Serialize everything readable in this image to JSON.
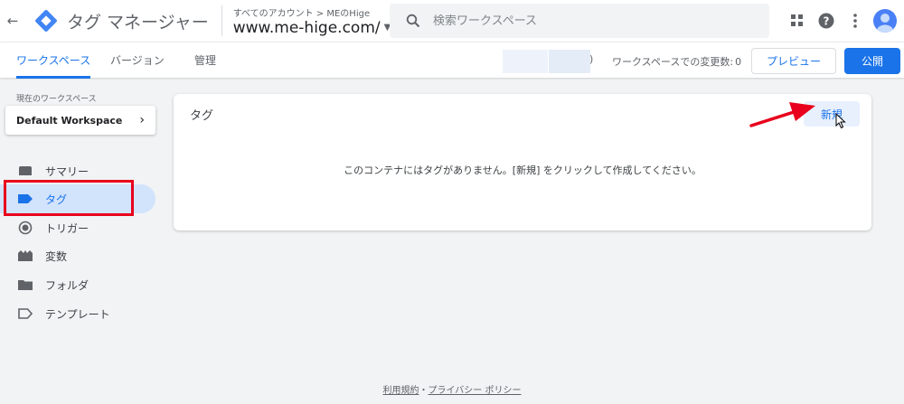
{
  "app": {
    "back_label": "←",
    "title": "タグ マネージャー",
    "breadcrumb": "すべてのアカウント > MEのHige",
    "container": "www.me-hige.com/"
  },
  "search": {
    "placeholder": "検索ワークスペース"
  },
  "top_icons": [
    "apps-icon",
    "help-icon",
    "more-vert-icon",
    "account-avatar"
  ],
  "tabs": [
    {
      "label": "ワークスペース",
      "active": true
    },
    {
      "label": "バージョン",
      "active": false
    },
    {
      "label": "管理",
      "active": false
    }
  ],
  "status": {
    "paren": ")",
    "changes_label": "ワークスペースでの変更数:",
    "changes_count": "0"
  },
  "buttons": {
    "preview": "プレビュー",
    "publish": "公開",
    "new": "新規"
  },
  "workspace": {
    "label": "現在のワークスペース",
    "name": "Default Workspace",
    "chevron": "›"
  },
  "sidebar": {
    "items": [
      {
        "label": "サマリー",
        "icon": "summary-icon",
        "selected": false
      },
      {
        "label": "タグ",
        "icon": "tag-icon",
        "selected": true
      },
      {
        "label": "トリガー",
        "icon": "trigger-icon",
        "selected": false
      },
      {
        "label": "変数",
        "icon": "variables-icon",
        "selected": false
      },
      {
        "label": "フォルダ",
        "icon": "folder-icon",
        "selected": false
      },
      {
        "label": "テンプレート",
        "icon": "template-icon",
        "selected": false
      }
    ]
  },
  "main": {
    "title": "タグ",
    "empty_message": "このコンテナにはタグがありません。[新規] をクリックして作成してください。"
  },
  "footer": {
    "terms": "利用規約",
    "separator": "・",
    "privacy": "プライバシー ポリシー"
  },
  "colors": {
    "accent": "#1a73e8",
    "selected_bg": "#d2e3fc",
    "highlight_box": "#e8001c",
    "annotation_arrow": "#e8001c"
  }
}
